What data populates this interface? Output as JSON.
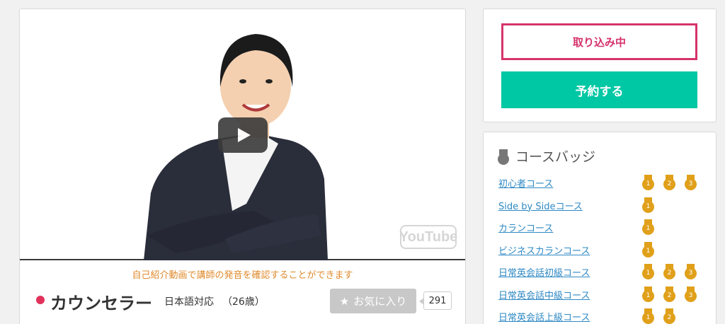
{
  "video": {
    "intro_text": "自己紹介動画で講師の発音を確認することができます",
    "logo": "YouTube"
  },
  "teacher": {
    "name": "カウンセラー",
    "language": "日本語対応",
    "age": "（26歳）"
  },
  "favorite": {
    "label": "お気に入り",
    "count": "291"
  },
  "actions": {
    "loading_label": "取り込み中",
    "reserve_label": "予約する"
  },
  "badges": {
    "heading": "コースバッジ",
    "courses": [
      {
        "name": "初心者コース",
        "medals": [
          "1",
          "2",
          "3"
        ]
      },
      {
        "name": "Side by Sideコース",
        "medals": [
          "1"
        ]
      },
      {
        "name": "カランコース",
        "medals": [
          "1"
        ]
      },
      {
        "name": "ビジネスカランコース",
        "medals": [
          "1"
        ]
      },
      {
        "name": "日常英会話初級コース",
        "medals": [
          "1",
          "2",
          "3"
        ]
      },
      {
        "name": "日常英会話中級コース",
        "medals": [
          "1",
          "2",
          "3"
        ]
      },
      {
        "name": "日常英会話上級コース",
        "medals": [
          "1",
          "2"
        ]
      }
    ]
  },
  "colors": {
    "accent_green": "#00c7a4",
    "accent_pink": "#d6336c",
    "medal_gold": "#e0a01a",
    "link_blue": "#2f89c4"
  }
}
